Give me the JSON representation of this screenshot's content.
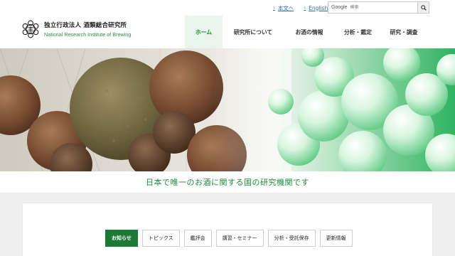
{
  "header": {
    "util_links": [
      {
        "label": "本文へ"
      },
      {
        "label": "English"
      }
    ],
    "search": {
      "brand": "Google",
      "placeholder": "検索"
    },
    "logo": {
      "org_jp": "独立行政法人 酒類総合研究所",
      "org_en": "National Research Institute of Brewing"
    },
    "nav": [
      {
        "label": "ホーム",
        "active": true
      },
      {
        "label": "研究所について"
      },
      {
        "label": "お酒の情報"
      },
      {
        "label": "分析・鑑定"
      },
      {
        "label": "研究・調査"
      }
    ]
  },
  "hero": {
    "tagline": "日本で唯一のお酒に関する国の研究機関です"
  },
  "news": {
    "tabs": [
      {
        "label": "お知らせ",
        "active": true
      },
      {
        "label": "トピックス"
      },
      {
        "label": "鑑評会"
      },
      {
        "label": "講習・セミナー"
      },
      {
        "label": "分析・受託保存"
      },
      {
        "label": "更新情報"
      }
    ]
  },
  "colors": {
    "accent_green": "#1d8a3c",
    "tab_active": "#1d7a36",
    "link_blue": "#2a6db0"
  }
}
